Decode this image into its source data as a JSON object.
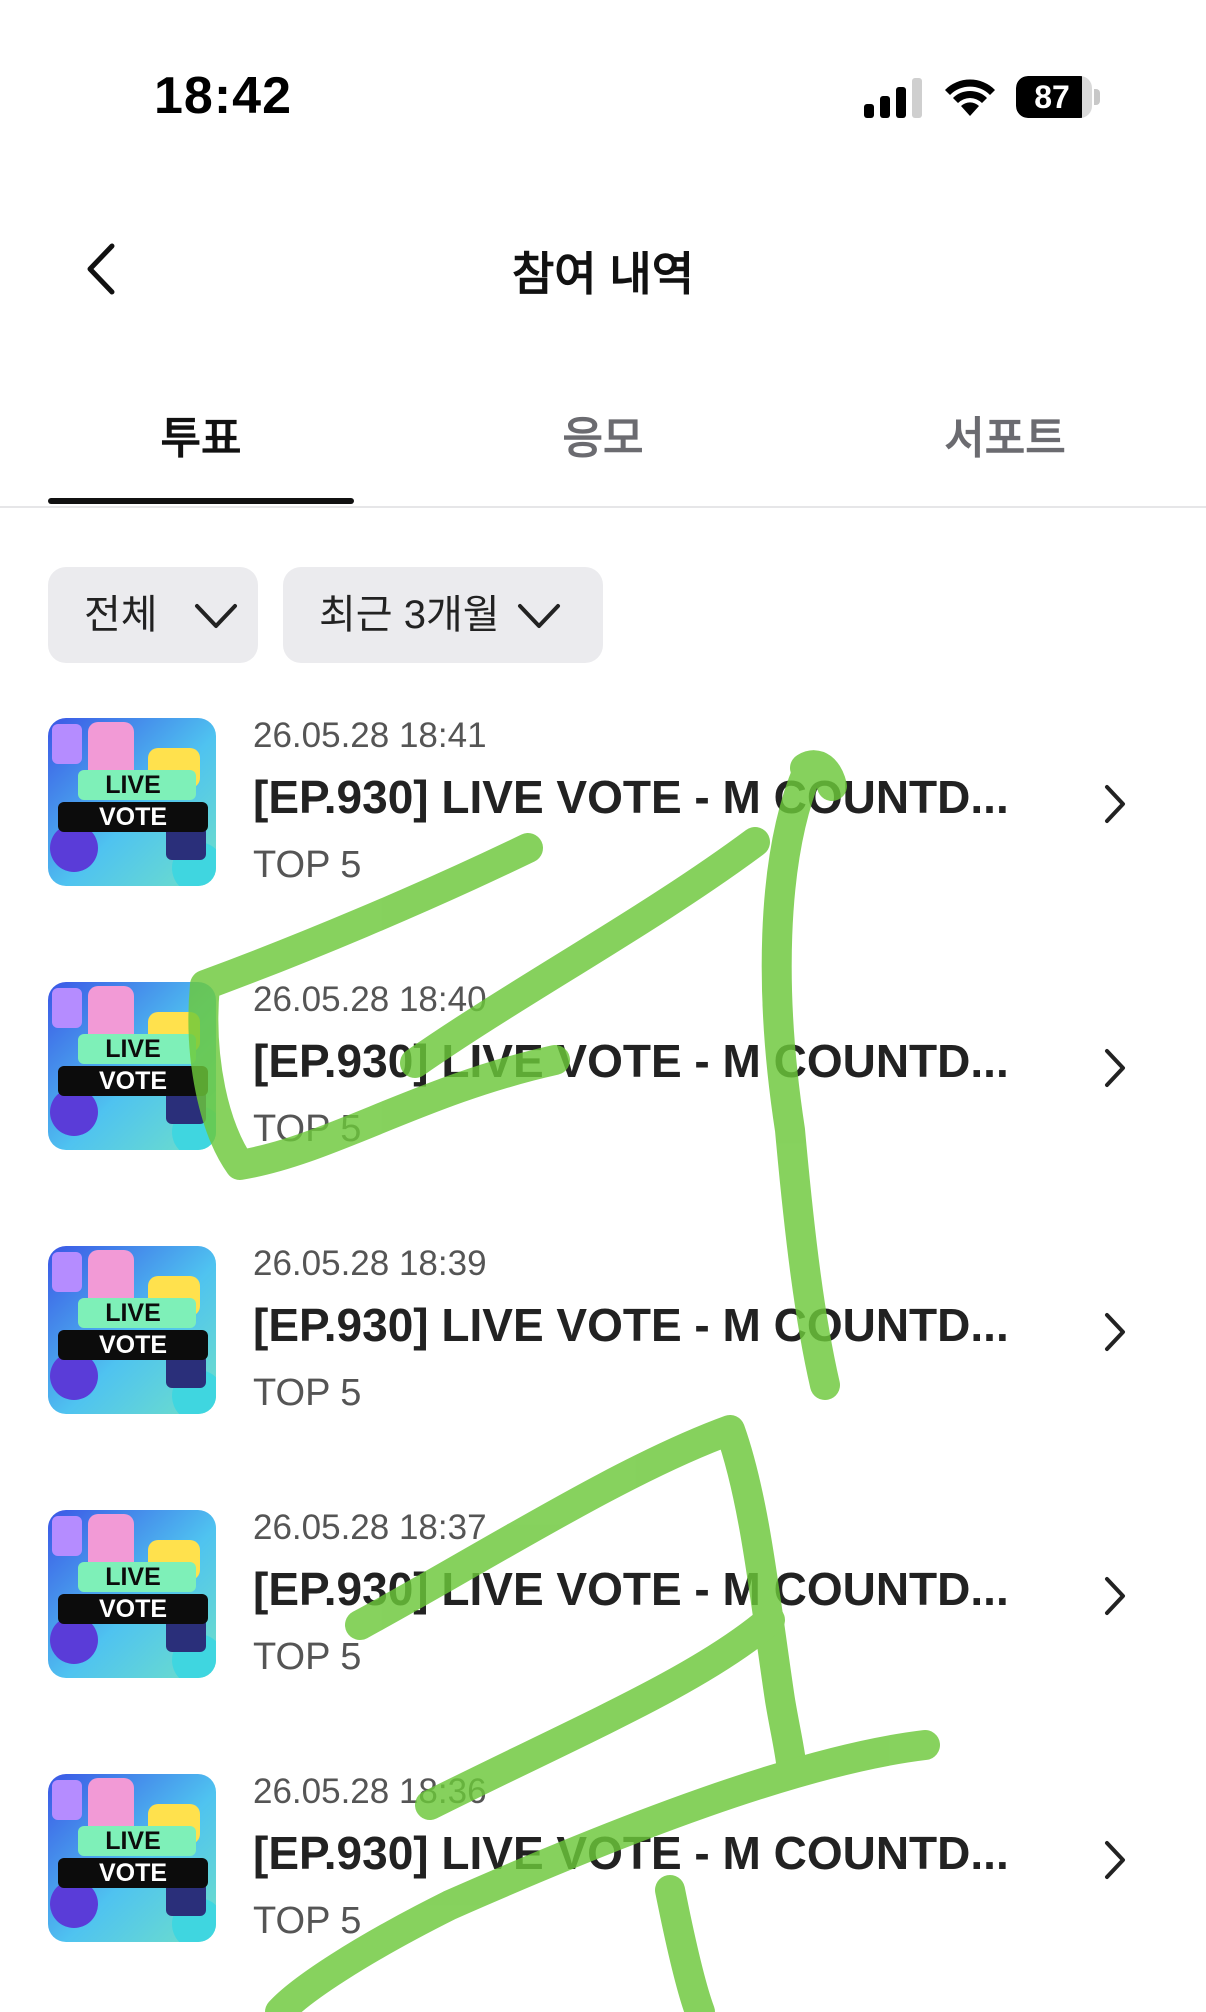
{
  "status_bar": {
    "time": "18:42",
    "battery": 87,
    "battery_label": "87"
  },
  "header": {
    "title": "참여 내역"
  },
  "tabs": [
    {
      "label": "투표",
      "active": true
    },
    {
      "label": "응모",
      "active": false
    },
    {
      "label": "서포트",
      "active": false
    }
  ],
  "filters": {
    "category": "전체",
    "period": "최근 3개월"
  },
  "thumbnail": {
    "line1": "LIVE",
    "line2": "VOTE"
  },
  "items": [
    {
      "date": "26.05.28 18:41",
      "title": "[EP.930] LIVE VOTE - M COUNTD...",
      "sub": "TOP 5"
    },
    {
      "date": "26.05.28 18:40",
      "title": "[EP.930] LIVE VOTE - M COUNTD...",
      "sub": "TOP 5"
    },
    {
      "date": "26.05.28 18:39",
      "title": "[EP.930] LIVE VOTE - M COUNTD...",
      "sub": "TOP 5"
    },
    {
      "date": "26.05.28 18:37",
      "title": "[EP.930] LIVE VOTE - M COUNTD...",
      "sub": "TOP 5"
    },
    {
      "date": "26.05.28 18:36",
      "title": "[EP.930] LIVE VOTE - M COUNTD...",
      "sub": "TOP 5"
    }
  ],
  "colors": {
    "scribble": "#6cc83a",
    "filter_bg": "#ebebee"
  }
}
